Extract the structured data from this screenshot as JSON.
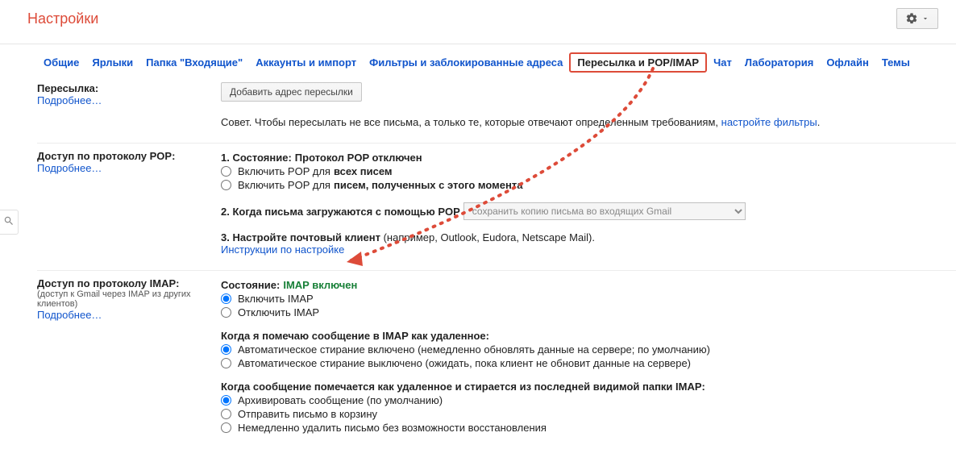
{
  "header": {
    "title": "Настройки"
  },
  "tabs": [
    "Общие",
    "Ярлыки",
    "Папка \"Входящие\"",
    "Аккаунты и импорт",
    "Фильтры и заблокированные адреса",
    "Пересылка и POP/IMAP",
    "Чат",
    "Лаборатория",
    "Офлайн",
    "Темы"
  ],
  "active_tab_index": 5,
  "forwarding": {
    "label": "Пересылка:",
    "more": "Подробнее…",
    "add_button": "Добавить адрес пересылки",
    "tip_prefix": "Совет. Чтобы пересылать не все письма, а только те, которые отвечают определенным требованиям, ",
    "tip_link": "настройте фильтры",
    "tip_suffix": "."
  },
  "pop": {
    "label": "Доступ по протоколу POP:",
    "more": "Подробнее…",
    "status_line_prefix": "1. Состояние: ",
    "status_line_bold": "Протокол POP отключен",
    "opt_all_prefix": "Включить POP для ",
    "opt_all_bold": "всех писем",
    "opt_new_prefix": "Включить POP для ",
    "opt_new_bold": "писем, полученных с этого момента",
    "when_label": "2. Когда письма загружаются с помощью POP",
    "when_select": "сохранить копию письма во входящих Gmail",
    "client_prefix": "3. Настройте почтовый клиент ",
    "client_rest": "(например, Outlook, Eudora, Netscape Mail).",
    "client_link": "Инструкции по настройке"
  },
  "imap": {
    "label": "Доступ по протоколу IMAP:",
    "sub": "(доступ к Gmail через IMAP из других клиентов)",
    "more": "Подробнее…",
    "status_prefix": "Состояние: ",
    "status_value": "IMAP включен",
    "opt_on": "Включить IMAP",
    "opt_off": "Отключить IMAP",
    "del_header": "Когда я помечаю сообщение в IMAP как удаленное:",
    "del_opt1": "Автоматическое стирание включено (немедленно обновлять данные на сервере; по умолчанию)",
    "del_opt2": "Автоматическое стирание выключено (ожидать, пока клиент не обновит данные на сервере)",
    "expunge_header": "Когда сообщение помечается как удаленное и стирается из последней видимой папки IMAP:",
    "exp_opt1": "Архивировать сообщение (по умолчанию)",
    "exp_opt2": "Отправить письмо в корзину",
    "exp_opt3": "Немедленно удалить письмо без возможности восстановления"
  }
}
